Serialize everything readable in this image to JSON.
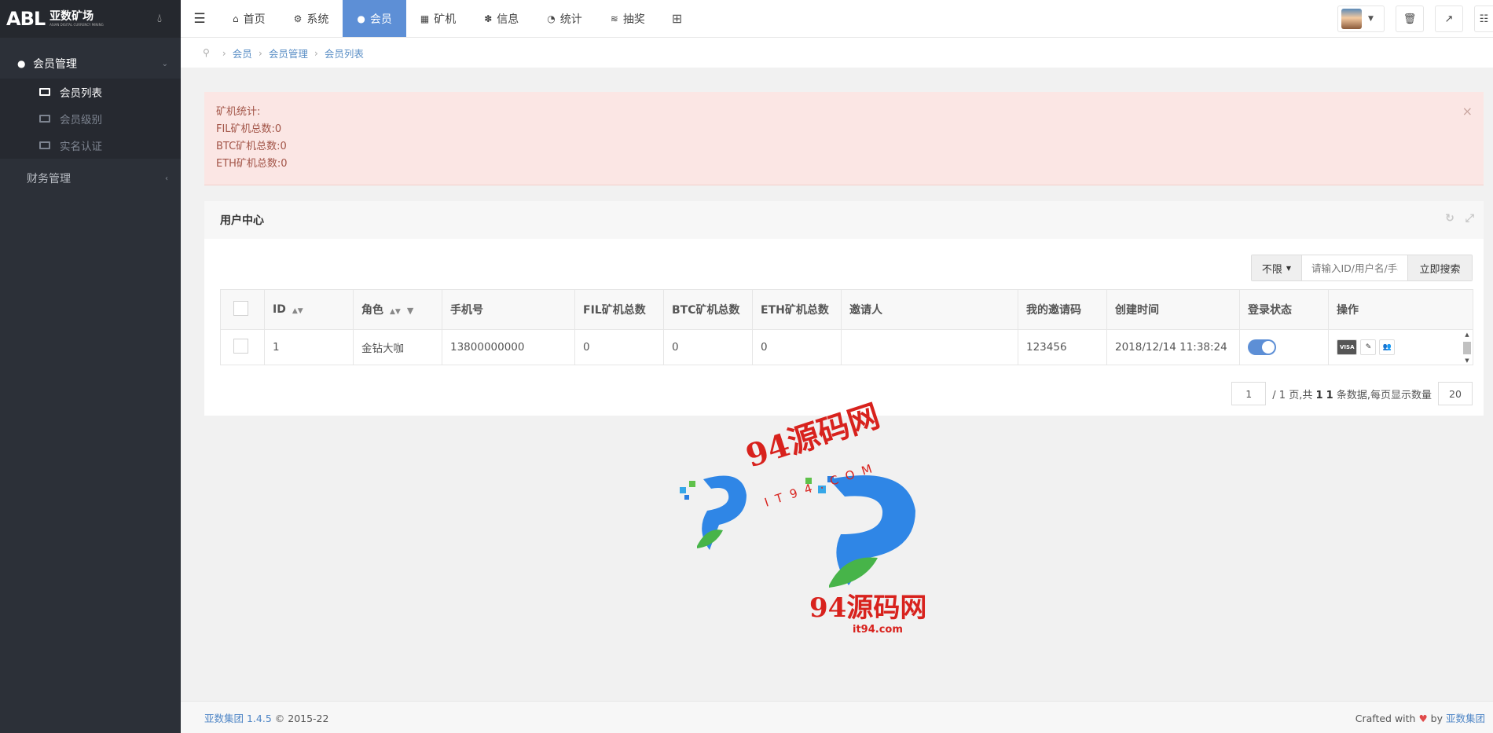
{
  "app": {
    "logo_mark": "ABL",
    "logo_name": "亚数矿场",
    "logo_sub": "ASIAN DIGITAL CURRENCY MINING"
  },
  "sidebar": {
    "groups": [
      {
        "label": "会员管理",
        "items": [
          {
            "label": "会员列表",
            "active": true
          },
          {
            "label": "会员级别",
            "active": false
          },
          {
            "label": "实名认证",
            "active": false
          }
        ]
      },
      {
        "label": "财务管理"
      }
    ]
  },
  "topnav": {
    "tabs": [
      {
        "label": "首页",
        "icon": "home-icon",
        "glyph": "⌂"
      },
      {
        "label": "系统",
        "icon": "gear-icon",
        "glyph": "⚙"
      },
      {
        "label": "会员",
        "icon": "user-icon",
        "glyph": "●",
        "active": true
      },
      {
        "label": "矿机",
        "icon": "windows-icon",
        "glyph": "▦"
      },
      {
        "label": "信息",
        "icon": "yelp-icon",
        "glyph": "✽"
      },
      {
        "label": "统计",
        "icon": "pie-chart-icon",
        "glyph": "◔"
      },
      {
        "label": "抽奖",
        "icon": "coins-icon",
        "glyph": "≋"
      }
    ]
  },
  "breadcrumb": [
    "会员",
    "会员管理",
    "会员列表"
  ],
  "alert": {
    "lines": [
      "矿机统计:",
      "FIL矿机总数:0",
      "BTC矿机总数:0",
      "ETH矿机总数:0"
    ]
  },
  "panel": {
    "title": "用户中心",
    "filter_label": "不限",
    "search_placeholder": "请输入ID/用户名/手机号",
    "search_button": "立即搜索",
    "columns": [
      "ID",
      "角色",
      "手机号",
      "FIL矿机总数",
      "BTC矿机总数",
      "ETH矿机总数",
      "邀请人",
      "我的邀请码",
      "创建时间",
      "登录状态",
      "操作"
    ],
    "rows": [
      {
        "id": "1",
        "role": "金钻大咖",
        "phone": "13800000000",
        "fil": "0",
        "btc": "0",
        "eth": "0",
        "inviter": "",
        "invite_code": "123456",
        "created": "2018/12/14 11:38:24",
        "login_enabled": true
      }
    ],
    "ops": {
      "visa": "VISA",
      "edit": "✎",
      "group": "👥"
    },
    "pager": {
      "page": "1",
      "text_total_pages": "/ 1 页,共",
      "total_pages": "1",
      "record_count": "1",
      "text_records": "条数据,每页显示数量",
      "page_size": "20"
    }
  },
  "watermark": {
    "title": "94源码网",
    "url_cap": "IT94.COM",
    "url": "it94.com"
  },
  "footer": {
    "brand": "亚数集团 1.4.5",
    "copyright": "© 2015-22",
    "crafted": "Crafted with",
    "heart": "♥",
    "by": "by",
    "author": "亚数集团"
  }
}
